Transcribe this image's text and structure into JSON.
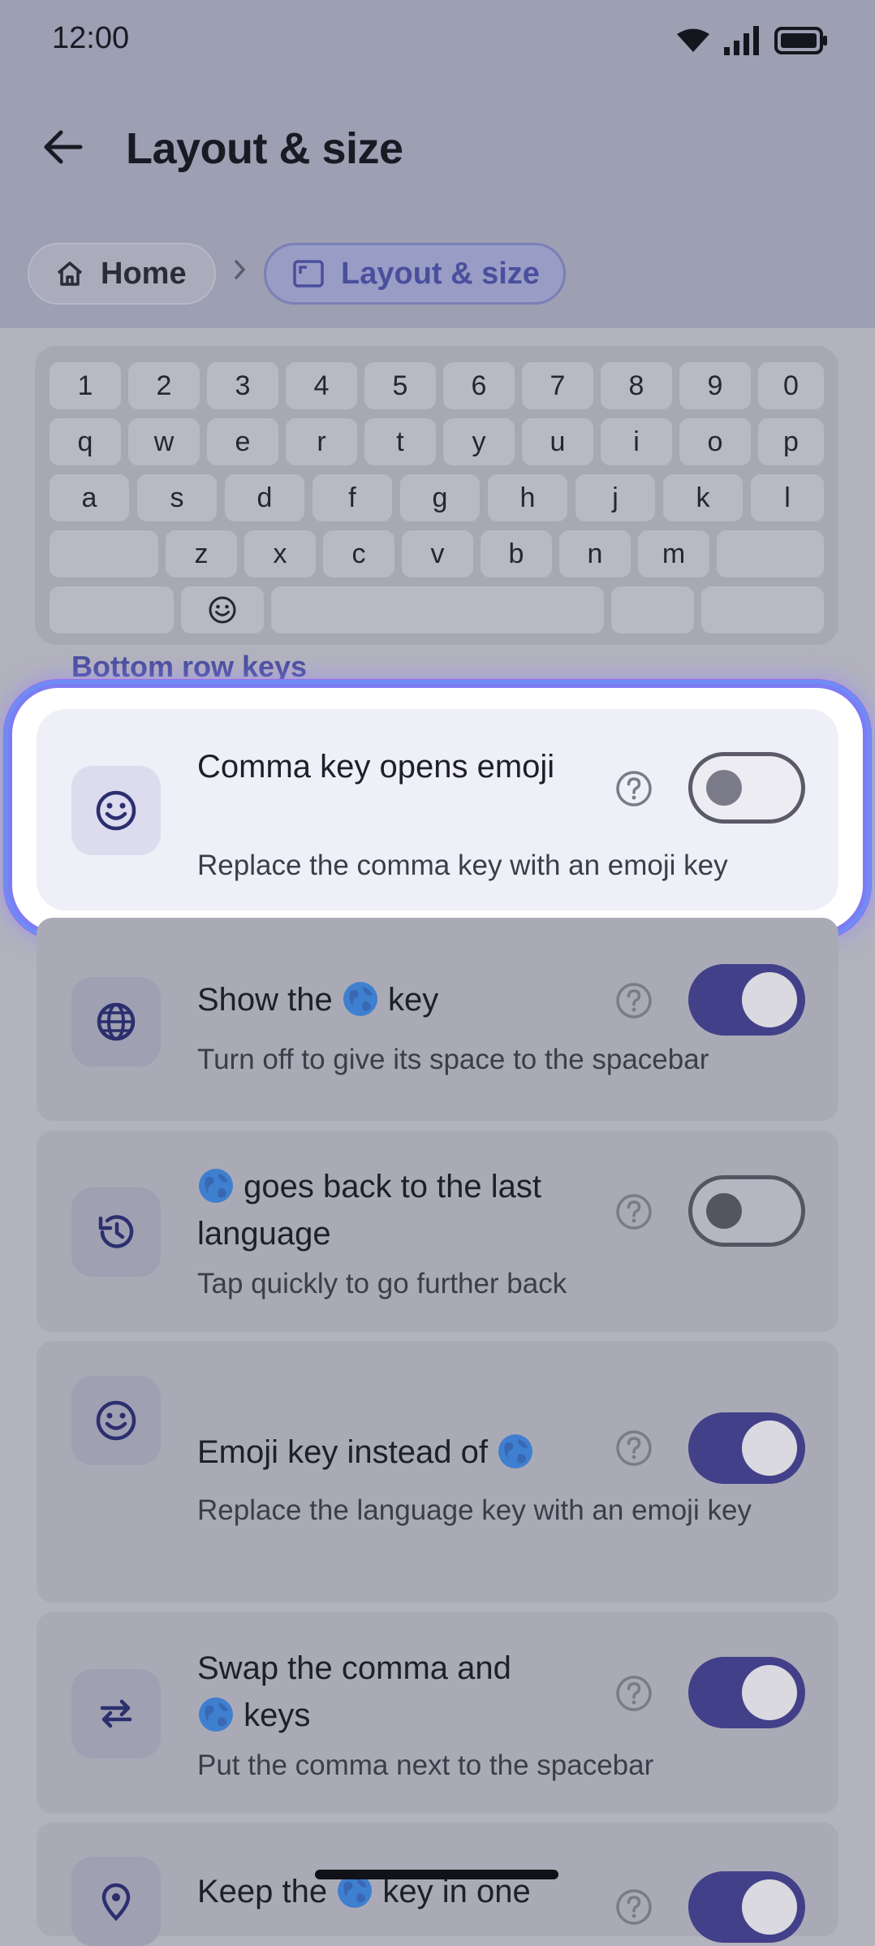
{
  "status": {
    "time": "12:00"
  },
  "header": {
    "title": "Layout & size"
  },
  "breadcrumb": {
    "home": "Home",
    "current": "Layout & size"
  },
  "keyboard": {
    "row1": [
      "1",
      "2",
      "3",
      "4",
      "5",
      "6",
      "7",
      "8",
      "9",
      "0"
    ],
    "row2": [
      "q",
      "w",
      "e",
      "r",
      "t",
      "y",
      "u",
      "i",
      "o",
      "p"
    ],
    "row3": [
      "a",
      "s",
      "d",
      "f",
      "g",
      "h",
      "j",
      "k",
      "l"
    ],
    "row4": [
      "z",
      "x",
      "c",
      "v",
      "b",
      "n",
      "m"
    ]
  },
  "section": {
    "label": "Bottom row keys"
  },
  "settings": [
    {
      "title": "Comma key opens emoji",
      "desc": "Replace the comma key with an emoji key",
      "icon": "emoji-icon",
      "enabled": false
    },
    {
      "title_pre": "Show the",
      "title_post": "key",
      "desc": "Turn off to give its space to the spacebar",
      "icon": "globe-icon",
      "enabled": true
    },
    {
      "title_post": "goes back to the last language",
      "desc": "Tap quickly to go further back",
      "icon": "history-icon",
      "enabled": false
    },
    {
      "title_pre": "Emoji key instead of",
      "desc": "Replace the language key with an emoji key",
      "icon": "emoji-icon",
      "enabled": true
    },
    {
      "title_pre": "Swap the comma and",
      "title_post": "keys",
      "desc": "Put the comma next to the spacebar",
      "icon": "swap-icon",
      "enabled": true
    },
    {
      "title_pre": "Keep the",
      "title_post": "key in one",
      "icon": "location-icon",
      "enabled": true
    }
  ]
}
